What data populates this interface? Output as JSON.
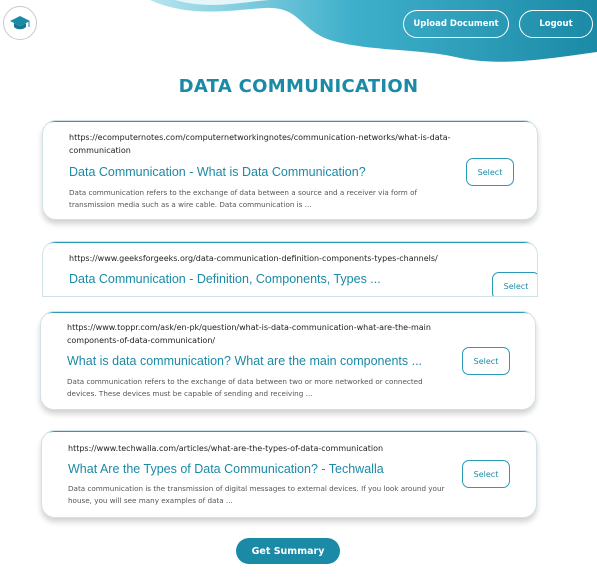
{
  "header": {
    "upload_label": "Upload Document",
    "logout_label": "Logout",
    "logo_icon": "graduation-cap-icon",
    "accent": "#1b8aa6"
  },
  "page_title": "DATA COMMUNICATION",
  "results": [
    {
      "url": "https://ecomputernotes.com/computernetworkingnotes/communication-networks/what-is-data-communication",
      "title": "Data Communication - What is Data Communication?",
      "snippet": "Data communication refers to the exchange of data between a source and a receiver via form of transmission media such as a wire cable. Data communication is ...",
      "select_label": "Select"
    },
    {
      "url": "https://www.geeksforgeeks.org/data-communication-definition-components-types-channels/",
      "title": "Data Communication - Definition, Components, Types ...",
      "snippet": "",
      "select_label": "Select"
    },
    {
      "url": "https://www.toppr.com/ask/en-pk/question/what-is-data-communication-what-are-the-main components-of-data-communication/",
      "title": "What is data communication? What are the main components ...",
      "snippet": "Data communication refers to the exchange of data between two or more networked or connected devices. These devices must be capable of sending and receiving ...",
      "select_label": "Select"
    },
    {
      "url": "https://www.techwalla.com/articles/what-are-the-types-of-data-communication",
      "title": "What Are the Types of Data Communication? - Techwalla",
      "snippet": "Data communication is the transmission of digital messages to external devices. If you look around your house, you will see many examples of data ...",
      "select_label": "Select"
    }
  ],
  "summary_label": "Get Summary"
}
